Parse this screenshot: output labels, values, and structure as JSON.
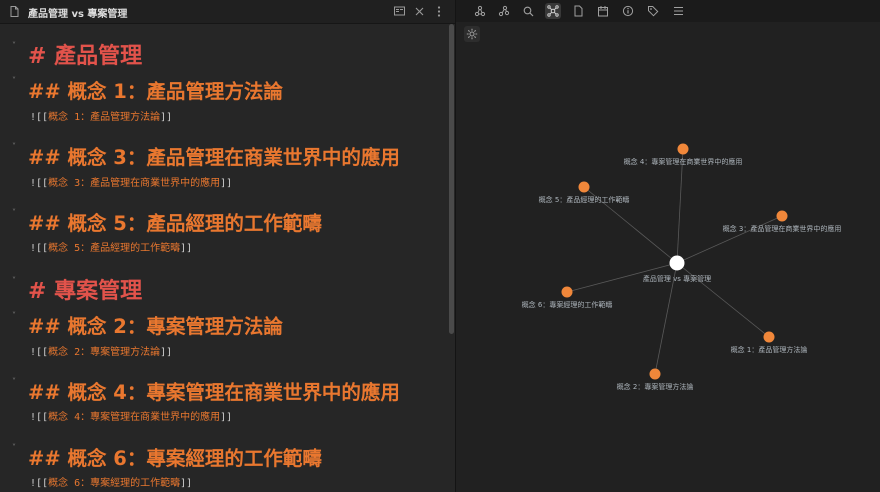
{
  "editor": {
    "title": "產品管理 vs 專案管理",
    "headings": [
      {
        "level": 1,
        "text": "# 產品管理"
      },
      {
        "level": 2,
        "text": "## 概念 1：產品管理方法論",
        "embed_prefix": "![[",
        "embed_link": "概念 1：產品管理方法論",
        "embed_suffix": "]]"
      },
      {
        "level": 2,
        "text": "## 概念 3：產品管理在商業世界中的應用",
        "embed_prefix": "![[",
        "embed_link": "概念 3：產品管理在商業世界中的應用",
        "embed_suffix": "]]"
      },
      {
        "level": 2,
        "text": "## 概念 5：產品經理的工作範疇",
        "embed_prefix": "![[",
        "embed_link": "概念 5：產品經理的工作範疇",
        "embed_suffix": "]]"
      },
      {
        "level": 1,
        "text": "# 專案管理"
      },
      {
        "level": 2,
        "text": "## 概念 2：專案管理方法論",
        "embed_prefix": "![[",
        "embed_link": "概念 2：專案管理方法論",
        "embed_suffix": "]]"
      },
      {
        "level": 2,
        "text": "## 概念 4：專案管理在商業世界中的應用",
        "embed_prefix": "![[",
        "embed_link": "概念 4：專案管理在商業世界中的應用",
        "embed_suffix": "]]"
      },
      {
        "level": 2,
        "text": "## 概念 6：專案經理的工作範疇",
        "embed_prefix": "![[",
        "embed_link": "概念 6：專案經理的工作範疇",
        "embed_suffix": "]]"
      }
    ],
    "fold_icon": "chevron-down-icon"
  },
  "graph": {
    "toolbar_icons": [
      "graph-icon",
      "graph-alt-icon",
      "search-icon",
      "local-graph-icon",
      "file-icon",
      "calendar-icon",
      "info-icon",
      "tags-icon",
      "outline-icon"
    ],
    "active_icon": "local-graph-icon",
    "center": {
      "label": "產品管理 vs 專案管理"
    },
    "nodes": [
      {
        "label": "概念 4：專案管理在商業世界中的應用"
      },
      {
        "label": "概念 5：產品經理的工作範疇"
      },
      {
        "label": "概念 3：產品管理在商業世界中的應用"
      },
      {
        "label": "概念 6：專案經理的工作範疇"
      },
      {
        "label": "概念 1：產品管理方法論"
      },
      {
        "label": "概念 2：專案管理方法論"
      }
    ],
    "colors": {
      "node": "#f0873a",
      "center": "#ffffff",
      "edge": "#595959",
      "h1": "#e2534b",
      "h2": "#e9772f"
    }
  }
}
